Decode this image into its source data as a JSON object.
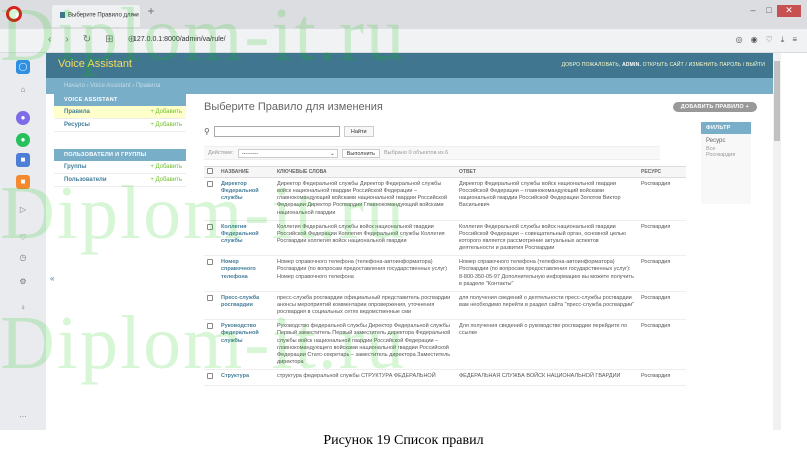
{
  "browser": {
    "tab_title": "Выберите Правило для и",
    "url": "127.0.0.1:8000/admin/va/rule/"
  },
  "admin": {
    "site_name": "Voice Assistant",
    "welcome": "ДОБРО ПОЖАЛОВАТЬ,",
    "username": "ADMIN.",
    "user_links": "ОТКРЫТЬ САЙТ / ИЗМЕНИТЬ ПАРОЛЬ / ВЫЙТИ",
    "breadcrumbs": {
      "home": "Начало",
      "app": "Voice Assistant",
      "current": "Правила"
    }
  },
  "nav": {
    "sections": [
      {
        "caption": "VOICE ASSISTANT",
        "items": [
          {
            "label": "Правила",
            "add": "+ Добавить"
          },
          {
            "label": "Ресурсы",
            "add": "+ Добавить"
          }
        ]
      },
      {
        "caption": "ПОЛЬЗОВАТЕЛИ И ГРУППЫ",
        "items": [
          {
            "label": "Группы",
            "add": "+ Добавить"
          },
          {
            "label": "Пользователи",
            "add": "+ Добавить"
          }
        ]
      }
    ],
    "collapse": "«"
  },
  "main": {
    "title": "Выберите Правило для изменения",
    "add_button": "ДОБАВИТЬ ПРАВИЛО +",
    "search_button": "Найти",
    "action_label": "Действие:",
    "action_value": "---------",
    "go_button": "Выполнить",
    "selected_count": "Выбрано 0 объектов из 6"
  },
  "table": {
    "headers": [
      "НАЗВАНИЕ",
      "КЛЮЧЕВЫЕ СЛОВА",
      "ОТВЕТ",
      "РЕСУРС"
    ],
    "rows": [
      {
        "name": "Директор Федеральной службы",
        "keywords": "Директор Федеральной службы Директор Федеральной службы войск национальной гвардии Российской Федерации – главнокомандующий войсками национальной гвардии Российской Федерации Директор Росгвардии Главнокомандующий войсками национальной гвардии",
        "answer": "Директор Федеральной службы войск национальной гвардии Российской Федерации – главнокомандующий войсками национальной гвардии Российской Федерации Золотов Виктор Васильевич",
        "resource": "Росгвардия"
      },
      {
        "name": "Коллегия Федеральной службы",
        "keywords": "Коллегия Федеральной службы войск национальной гвардии Российской Федерации Коллегия Федеральной службы Коллегия Росгвардии коллегия войск национальной гвардии",
        "answer": "Коллегия Федеральной службы войск национальной гвардии Российской Федерации – совещательный орган, основной целью которого является рассмотрение актуальных аспектов деятельности и развития Росгвардии",
        "resource": "Росгвардия"
      },
      {
        "name": "Номер справочного телефона",
        "keywords": "Номер справочного телефона (телефона-автоинформатора) Росгвардии (по вопросам предоставления государственных услуг) Номер справочного телефона",
        "answer": "Номер справочного телефона (телефона-автоинформатора) Росгвардии (по вопросам предоставления государственных услуг): 8-800-350-05-97 Дополнительную информацию вы можете получить в разделе \"Контакты\"",
        "resource": "Росгвардия"
      },
      {
        "name": "Пресс-служба росгвардии",
        "keywords": "пресс-служба росгвардии официальный представитель росгвардии анонсы мероприятий комментарии опровержения, уточнения росгвардия в социальных сетях ведомственные сми",
        "answer": "для получения сведений о деятельности пресс-службы росгвардии вам необходимо перейти в раздел сайта \"пресс-служба росгвардии\"",
        "resource": "Росгвардия"
      },
      {
        "name": "Руководство федеральной службы",
        "keywords": "Руководство федеральной службы Директор Федеральной службы Первый заместитель Первый заместитель директора Федеральной службы войск национальной гвардии Российской Федерации – главнокомандующего войсками национальной гвардии Российской Федерации Статс-секретарь – заместитель директора Заместитель директора",
        "answer": "Для получения сведений о руководстве росгвардии перейдите по ссылке",
        "resource": "Росгвардия"
      },
      {
        "name": "Структура",
        "keywords": "структура федеральной службы СТРУКТУРА ФЕДЕРАЛЬНОЙ",
        "answer": "ФЕДЕРАЛЬНАЯ СЛУЖБА ВОЙСК НАЦИОНАЛЬНОЙ ГВАРДИИ",
        "resource": "Росгвардия"
      }
    ]
  },
  "filter": {
    "title": "ФИЛЬТР",
    "subtitle": "Ресурс",
    "option": "Все Росгвардия"
  },
  "caption": "Рисунок 19    Список правил",
  "watermark": "Diplom-it.ru",
  "colors": {
    "header": "#417690",
    "accent": "#79aec8",
    "link": "#447e9b",
    "add": "#70bf2b",
    "site_name": "#f5dd5d",
    "opera": "#d6231c"
  }
}
